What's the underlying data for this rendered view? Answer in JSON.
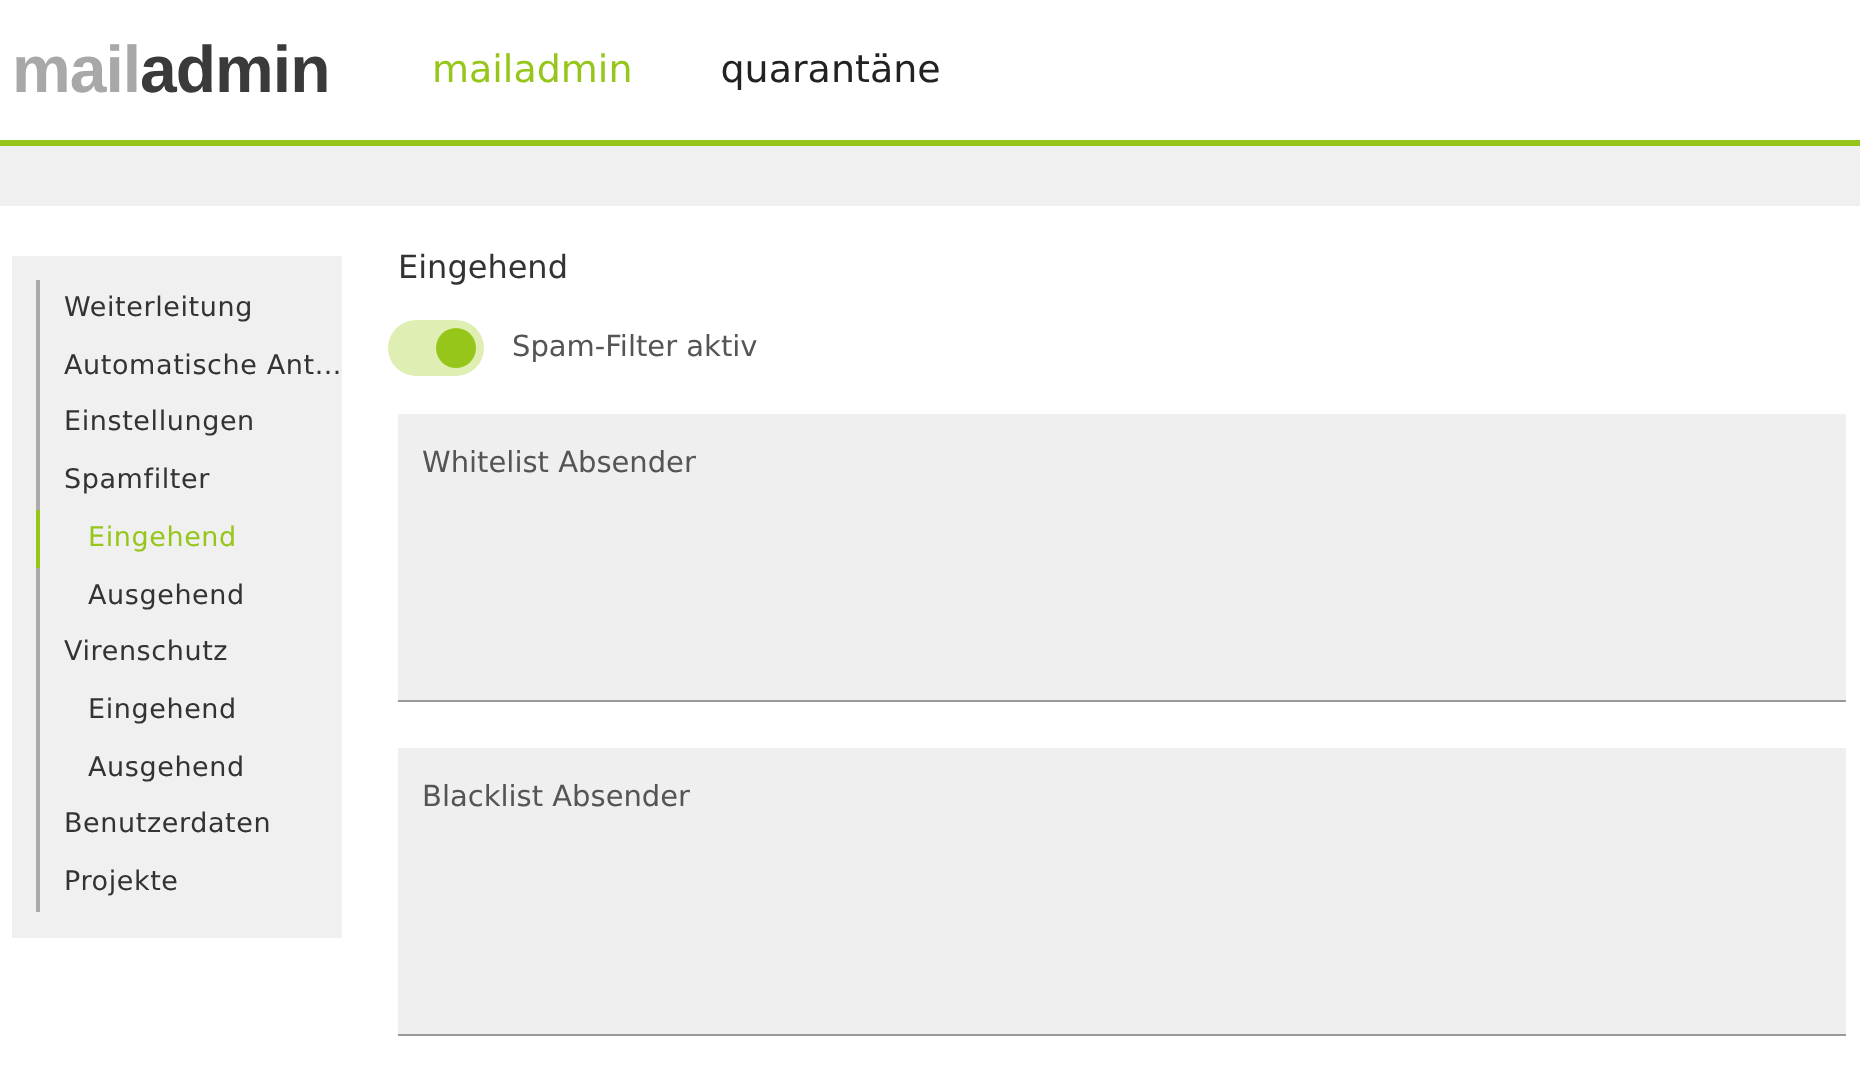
{
  "logo": {
    "light": "mail",
    "dark": "admin"
  },
  "nav": [
    {
      "label": "mailadmin",
      "selected": true
    },
    {
      "label": "quarantäne",
      "selected": false
    }
  ],
  "sidebar": {
    "items": [
      {
        "label": "Weiterleitung",
        "selected": false
      },
      {
        "label": "Automatische Ant…",
        "selected": false
      },
      {
        "label": "Einstellungen",
        "selected": false
      },
      {
        "label": "Spamfilter",
        "selected": false,
        "children": [
          {
            "label": "Eingehend",
            "selected": true
          },
          {
            "label": "Ausgehend",
            "selected": false
          }
        ]
      },
      {
        "label": "Virenschutz",
        "selected": false,
        "children": [
          {
            "label": "Eingehend",
            "selected": false
          },
          {
            "label": "Ausgehend",
            "selected": false
          }
        ]
      },
      {
        "label": "Benutzerdaten",
        "selected": false
      },
      {
        "label": "Projekte",
        "selected": false
      }
    ]
  },
  "content": {
    "title": "Eingehend",
    "toggle": {
      "label": "Spam-Filter aktiv",
      "on": true
    },
    "fields": [
      {
        "placeholder": "Whitelist Absender"
      },
      {
        "placeholder": "Blacklist Absender"
      }
    ]
  }
}
